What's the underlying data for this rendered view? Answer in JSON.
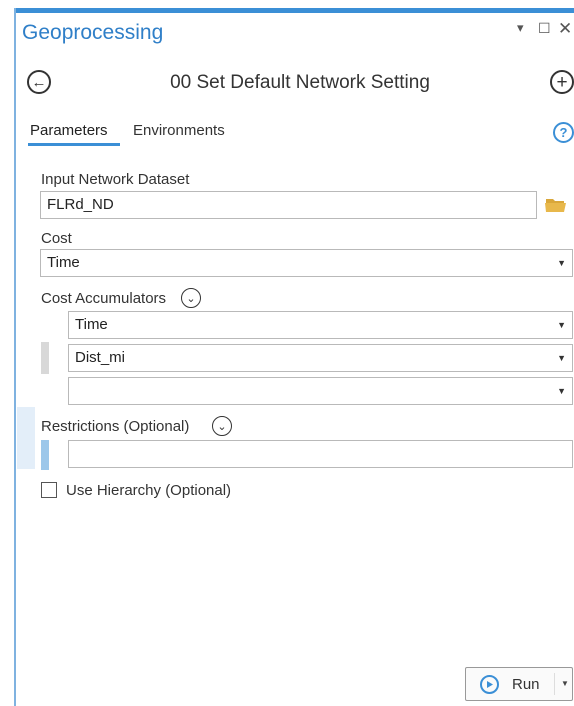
{
  "pane": {
    "title": "Geoprocessing",
    "controls": {
      "pin": "▾",
      "maximize": "☐",
      "close": "✕"
    }
  },
  "tool": {
    "title": "00 Set Default Network Setting",
    "back_icon": "←",
    "add_icon": "+"
  },
  "tabs": [
    {
      "label": "Parameters",
      "active": true
    },
    {
      "label": "Environments",
      "active": false
    }
  ],
  "help_icon": "?",
  "params": {
    "input_network": {
      "label": "Input Network Dataset",
      "value": "FLRd_ND"
    },
    "cost": {
      "label": "Cost",
      "value": "Time"
    },
    "cost_accumulators": {
      "label": "Cost Accumulators",
      "values": [
        "Time",
        "Dist_mi",
        ""
      ]
    },
    "restrictions": {
      "label": "Restrictions (Optional)",
      "value": ""
    },
    "use_hierarchy": {
      "label": "Use Hierarchy (Optional)",
      "checked": false
    }
  },
  "run_button": {
    "label": "Run"
  },
  "colors": {
    "accent": "#3b8fd6",
    "folder": "#e8b84b"
  }
}
